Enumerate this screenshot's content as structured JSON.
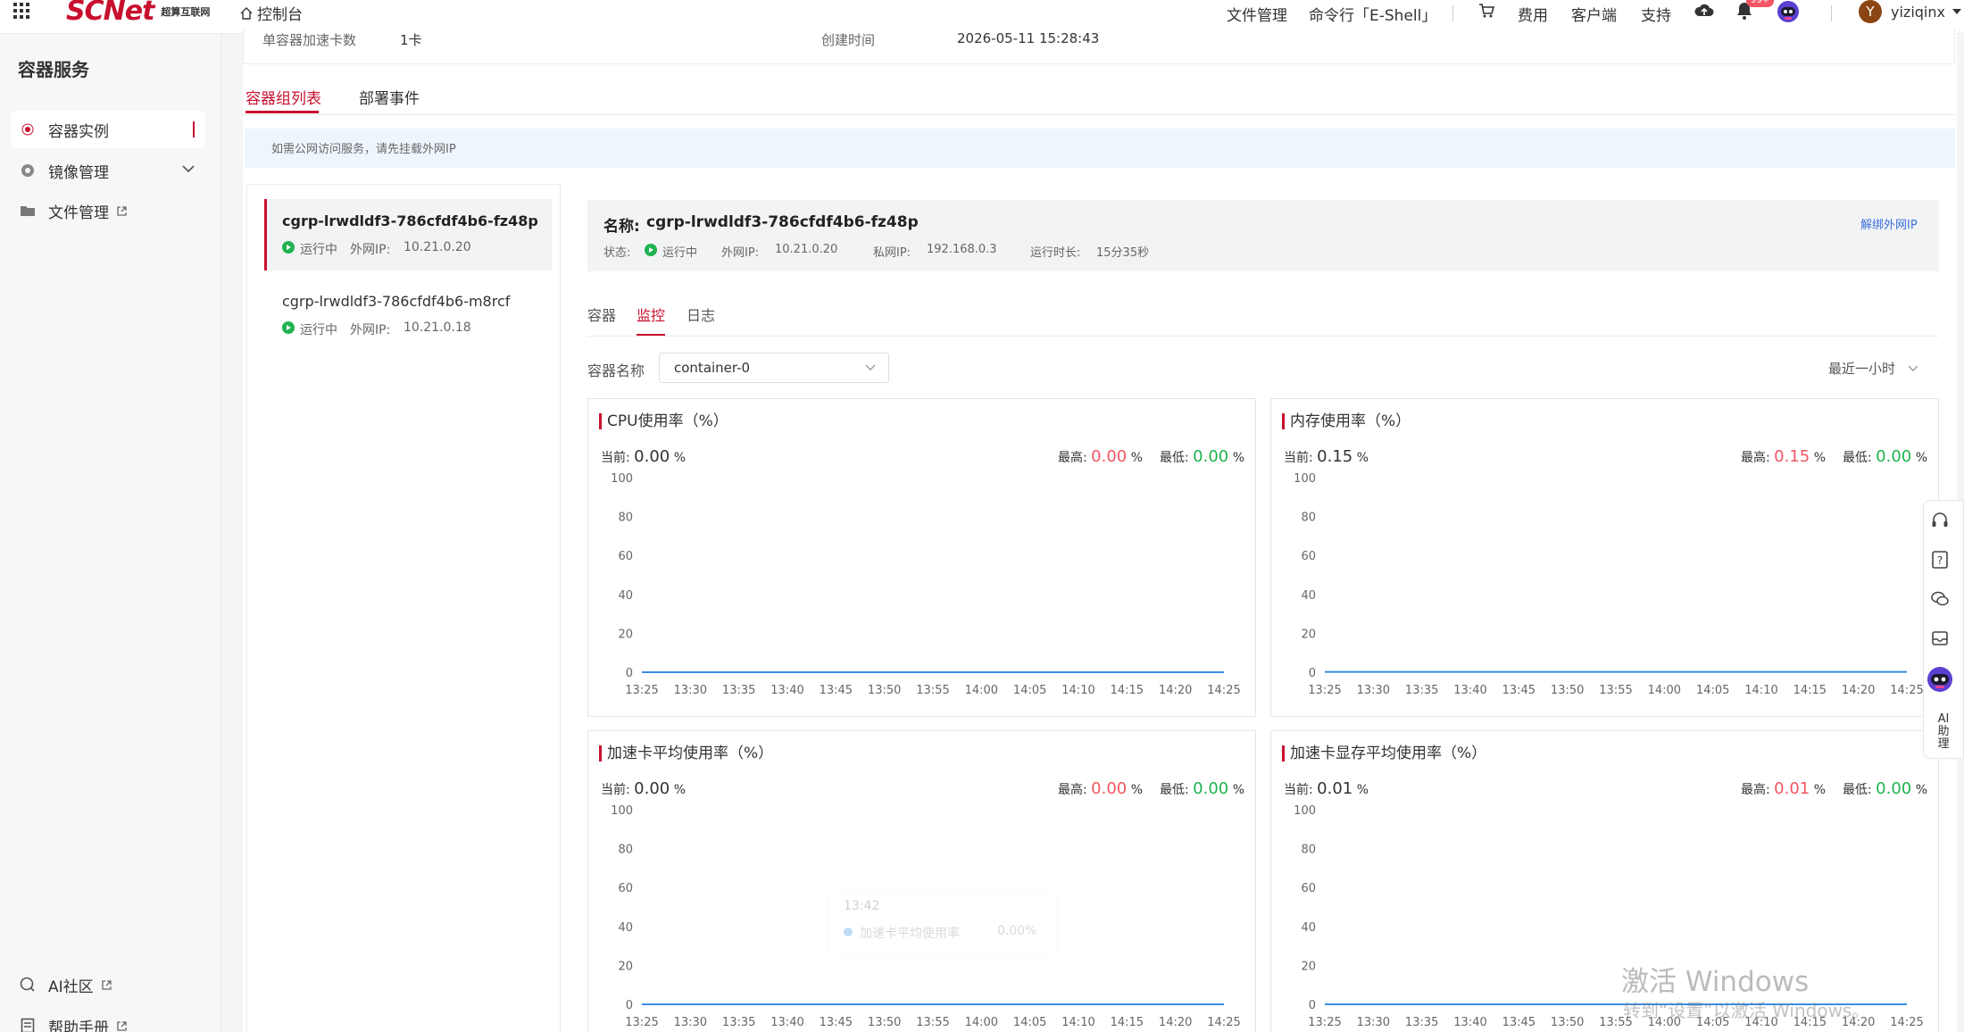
{
  "topbar": {
    "brand": "SCNet",
    "brand_sub": "超算互联网",
    "console_link": "控制台",
    "nav": [
      "文件管理",
      "命令行「E-Shell」",
      "费用",
      "客户端",
      "支持"
    ],
    "badge": "99+",
    "user_initial": "Y",
    "username": "yiziqinx"
  },
  "sidebar": {
    "title": "容器服务",
    "items": [
      {
        "label": "容器实例"
      },
      {
        "label": "镜像管理"
      },
      {
        "label": "文件管理"
      }
    ],
    "bottom": [
      {
        "label": "AI社区"
      },
      {
        "label": "帮助手册"
      }
    ]
  },
  "info_strip": {
    "label1": "单容器加速卡数",
    "value1": "1卡",
    "label2": "创建时间",
    "value2": "2026-05-11 15:28:43"
  },
  "tabs": [
    "容器组列表",
    "部署事件"
  ],
  "notice": "如需公网访问服务，请先挂载外网IP",
  "groups": [
    {
      "name": "cgrp-lrwdldf3-786cfdf4b6-fz48p",
      "status": "运行中",
      "ip_label": "外网IP:",
      "ip": "10.21.0.20"
    },
    {
      "name": "cgrp-lrwdldf3-786cfdf4b6-m8rcf",
      "status": "运行中",
      "ip_label": "外网IP:",
      "ip": "10.21.0.18"
    }
  ],
  "detail": {
    "name_label": "名称:",
    "name": "cgrp-lrwdldf3-786cfdf4b6-fz48p",
    "unbind": "解绑外网IP",
    "status_label": "状态:",
    "status": "运行中",
    "public_ip_label": "外网IP:",
    "public_ip": "10.21.0.20",
    "private_ip_label": "私网IP:",
    "private_ip": "192.168.0.3",
    "uptime_label": "运行时长:",
    "uptime": "15分35秒",
    "subtabs": [
      "容器",
      "监控",
      "日志"
    ],
    "container_label": "容器名称",
    "container_value": "container-0",
    "time_range": "最近一小时"
  },
  "stat_labels": {
    "current": "当前:",
    "max": "最高:",
    "min": "最低:",
    "unit": "%"
  },
  "charts": [
    {
      "title": "CPU使用率（%）",
      "current": "0.00",
      "max": "0.00",
      "min": "0.00"
    },
    {
      "title": "内存使用率（%）",
      "current": "0.15",
      "max": "0.15",
      "min": "0.00"
    },
    {
      "title": "加速卡平均使用率（%）",
      "current": "0.00",
      "max": "0.00",
      "min": "0.00"
    },
    {
      "title": "加速卡显存平均使用率（%）",
      "current": "0.01",
      "max": "0.01",
      "min": "0.00"
    }
  ],
  "chart_data": [
    {
      "type": "line",
      "title": "CPU使用率（%）",
      "x": [
        "13:25",
        "13:30",
        "13:35",
        "13:40",
        "13:45",
        "13:50",
        "13:55",
        "14:00",
        "14:05",
        "14:10",
        "14:15",
        "14:20",
        "14:25"
      ],
      "y_ticks": [
        0,
        20,
        40,
        60,
        80,
        100
      ],
      "ylim": [
        0,
        100
      ],
      "series": [
        {
          "values": [
            0,
            0,
            0,
            0,
            0,
            0,
            0,
            0,
            0,
            0,
            0,
            0,
            0
          ]
        }
      ],
      "grid": false
    },
    {
      "type": "line",
      "title": "内存使用率（%）",
      "x": [
        "13:25",
        "13:30",
        "13:35",
        "13:40",
        "13:45",
        "13:50",
        "13:55",
        "14:00",
        "14:05",
        "14:10",
        "14:15",
        "14:20",
        "14:25"
      ],
      "y_ticks": [
        0,
        20,
        40,
        60,
        80,
        100
      ],
      "ylim": [
        0,
        100
      ],
      "series": [
        {
          "values": [
            0.15,
            0.15,
            0.15,
            0.15,
            0.15,
            0.15,
            0.15,
            0.15,
            0.15,
            0.15,
            0.15,
            0.15,
            0.15
          ]
        }
      ],
      "grid": false
    },
    {
      "type": "line",
      "title": "加速卡平均使用率（%）",
      "x": [
        "13:25",
        "13:30",
        "13:35",
        "13:40",
        "13:45",
        "13:50",
        "13:55",
        "14:00",
        "14:05",
        "14:10",
        "14:15",
        "14:20",
        "14:25"
      ],
      "y_ticks": [
        0,
        20,
        40,
        60,
        80,
        100
      ],
      "ylim": [
        0,
        100
      ],
      "series": [
        {
          "values": [
            0,
            0,
            0,
            0,
            0,
            0,
            0,
            0,
            0,
            0,
            0,
            0,
            0
          ]
        }
      ],
      "grid": false
    },
    {
      "type": "line",
      "title": "加速卡显存平均使用率（%）",
      "x": [
        "13:25",
        "13:30",
        "13:35",
        "13:40",
        "13:45",
        "13:50",
        "13:55",
        "14:00",
        "14:05",
        "14:10",
        "14:15",
        "14:20",
        "14:25"
      ],
      "y_ticks": [
        0,
        20,
        40,
        60,
        80,
        100
      ],
      "ylim": [
        0,
        100
      ],
      "series": [
        {
          "values": [
            0.01,
            0.01,
            0.01,
            0.01,
            0.01,
            0.01,
            0.01,
            0.01,
            0.01,
            0.01,
            0.01,
            0.01,
            0.01
          ]
        }
      ],
      "grid": false
    }
  ],
  "tooltip": {
    "time": "13:42",
    "label": "加速卡平均使用率",
    "value": "0.00%"
  },
  "assistant": {
    "label": "AI助理"
  },
  "watermark": {
    "line1": "激活 Windows",
    "line2": "转到“设置”以激活 Windows。"
  },
  "colors": {
    "accent": "#c8102e",
    "line": "#3a8ee6",
    "running": "#1fb350",
    "max": "#f25563",
    "min": "#1fb350"
  }
}
